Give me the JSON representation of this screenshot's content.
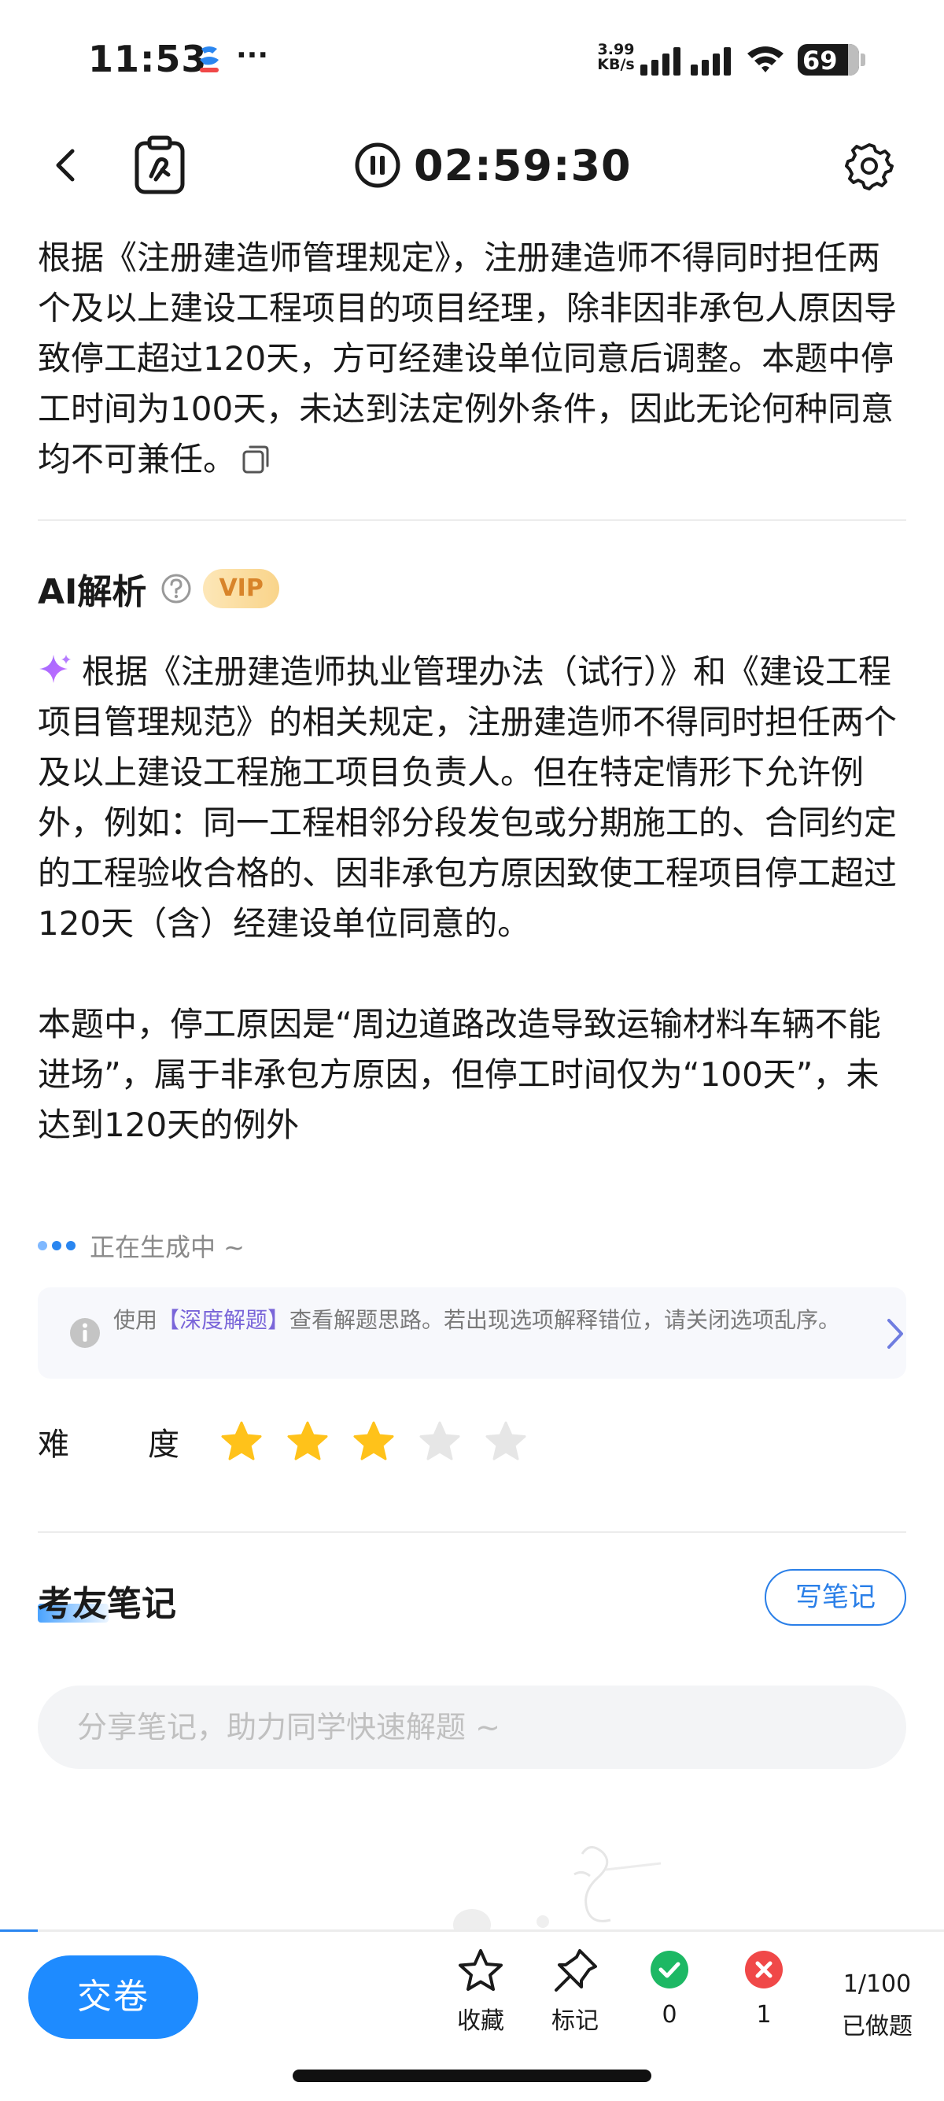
{
  "status_bar": {
    "time": "11:53",
    "dots": "···",
    "network_speed_value": "3.99",
    "network_speed_unit": "KB/s",
    "battery": "69"
  },
  "nav": {
    "timer": "02:59:30"
  },
  "answer_explanation": "根据《注册建造师管理规定》，注册建造师不得同时担任两个及以上建设工程项目的项目经理，除非因非承包人原因导致停工超过120天，方可经建设单位同意后调整。本题中停工时间为100天，未达到法定例外条件，因此无论何种同意均不可兼任。",
  "ai_analysis": {
    "title": "AI解析",
    "badge": "VIP",
    "paragraph1": "根据《注册建造师执业管理办法（试行）》和《建设工程项目管理规范》的相关规定，注册建造师不得同时担任两个及以上建设工程施工项目负责人。但在特定情形下允许例外，例如：同一工程相邻分段发包或分期施工的、合同约定的工程验收合格的、因非承包方原因致使工程项目停工超过120天（含）经建设单位同意的。",
    "paragraph2": "本题中，停工原因是“周边道路改造导致运输材料车辆不能进场”，属于非承包方原因，但停工时间仅为“100天”，未达到120天的例外",
    "generating": "正在生成中 ~"
  },
  "tip": {
    "prefix": "使用",
    "highlight": "【深度解题】",
    "suffix": "查看解题思路。若出现选项解释错位，请关闭选项乱序。"
  },
  "difficulty": {
    "label_char1": "难",
    "label_char2": "度",
    "rating": 3,
    "max": 5,
    "star_on_color": "#FFC21A",
    "star_off_color": "#E6E6E6"
  },
  "notes": {
    "title": "考友笔记",
    "write_button": "写笔记",
    "placeholder": "分享笔记，助力同学快速解题 ~"
  },
  "bottom_bar": {
    "submit": "交卷",
    "favorite": "收藏",
    "mark": "标记",
    "correct_count": "0",
    "wrong_count": "1",
    "progress": "1/100",
    "progress_label": "已做题",
    "progress_fraction": 0.01
  },
  "colors": {
    "accent": "#1E8BFF",
    "correct": "#1DB864",
    "wrong": "#F04848",
    "vip_text": "#D8842A",
    "tip_highlight": "#7A66D9"
  }
}
